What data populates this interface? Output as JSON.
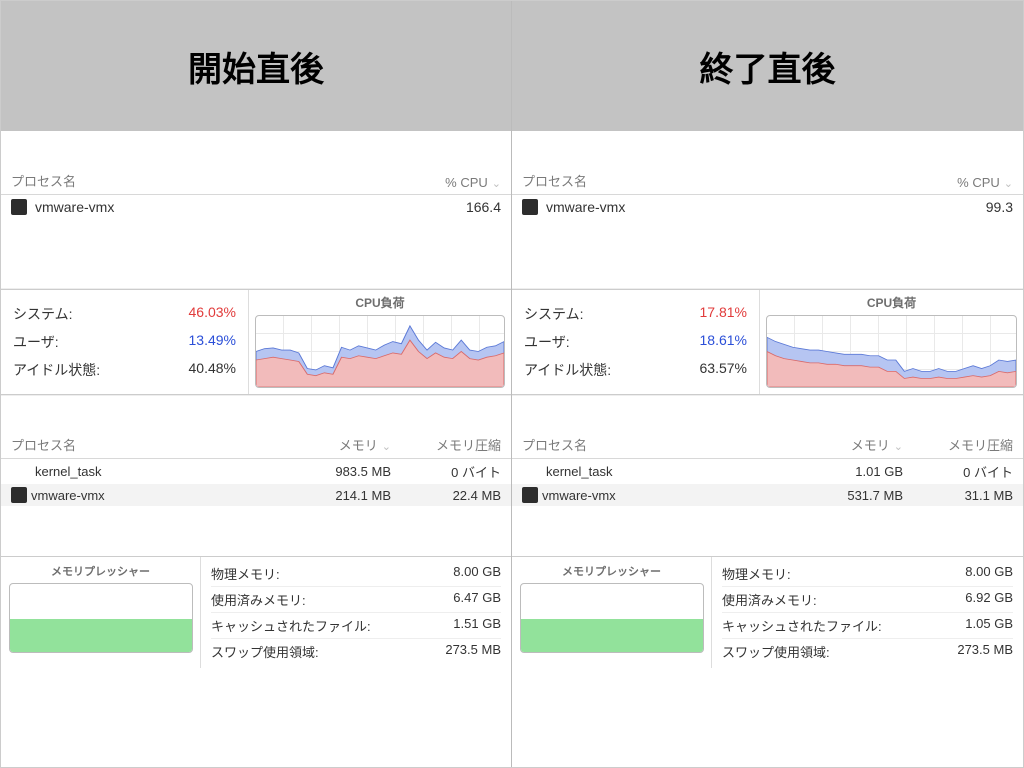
{
  "panes": [
    {
      "title": "開始直後",
      "cpu_proc": {
        "header_name": "プロセス名",
        "header_cpu": "% CPU",
        "rows": [
          {
            "name": "vmware-vmx",
            "cpu": "166.4",
            "has_icon": true
          }
        ]
      },
      "cpu_stats": {
        "system_label": "システム:",
        "system_val": "46.03%",
        "user_label": "ユーザ:",
        "user_val": "13.49%",
        "idle_label": "アイドル状態:",
        "idle_val": "40.48%",
        "chart_title": "CPU負荷"
      },
      "mem_proc": {
        "header_name": "プロセス名",
        "header_mem": "メモリ",
        "header_comp": "メモリ圧縮",
        "rows": [
          {
            "name": "kernel_task",
            "mem": "983.5 MB",
            "comp": "0 バイト",
            "has_icon": false
          },
          {
            "name": "vmware-vmx",
            "mem": "214.1 MB",
            "comp": "22.4 MB",
            "has_icon": true
          }
        ]
      },
      "mem_pressure": {
        "title": "メモリプレッシャー",
        "fill_pct": 48,
        "rows": [
          {
            "label": "物理メモリ:",
            "val": "8.00 GB"
          },
          {
            "label": "使用済みメモリ:",
            "val": "6.47 GB"
          },
          {
            "label": "キャッシュされたファイル:",
            "val": "1.51 GB"
          },
          {
            "label": "スワップ使用領域:",
            "val": "273.5 MB"
          }
        ]
      }
    },
    {
      "title": "終了直後",
      "cpu_proc": {
        "header_name": "プロセス名",
        "header_cpu": "% CPU",
        "rows": [
          {
            "name": "vmware-vmx",
            "cpu": "99.3",
            "has_icon": true
          }
        ]
      },
      "cpu_stats": {
        "system_label": "システム:",
        "system_val": "17.81%",
        "user_label": "ユーザ:",
        "user_val": "18.61%",
        "idle_label": "アイドル状態:",
        "idle_val": "63.57%",
        "chart_title": "CPU負荷"
      },
      "mem_proc": {
        "header_name": "プロセス名",
        "header_mem": "メモリ",
        "header_comp": "メモリ圧縮",
        "rows": [
          {
            "name": "kernel_task",
            "mem": "1.01 GB",
            "comp": "0 バイト",
            "has_icon": false
          },
          {
            "name": "vmware-vmx",
            "mem": "531.7 MB",
            "comp": "31.1 MB",
            "has_icon": true
          }
        ]
      },
      "mem_pressure": {
        "title": "メモリプレッシャー",
        "fill_pct": 48,
        "rows": [
          {
            "label": "物理メモリ:",
            "val": "8.00 GB"
          },
          {
            "label": "使用済みメモリ:",
            "val": "6.92 GB"
          },
          {
            "label": "キャッシュされたファイル:",
            "val": "1.05 GB"
          },
          {
            "label": "スワップ使用領域:",
            "val": "273.5 MB"
          }
        ]
      }
    }
  ],
  "chart_data": [
    {
      "type": "area",
      "title": "CPU負荷 (開始直後)",
      "x": [
        0,
        1,
        2,
        3,
        4,
        5,
        6,
        7,
        8,
        9,
        10,
        11,
        12,
        13,
        14,
        15,
        16,
        17,
        18,
        19,
        20,
        21,
        22,
        23,
        24,
        25,
        26,
        27,
        28,
        29
      ],
      "series": [
        {
          "name": "システム",
          "color": "#e98989",
          "values": [
            38,
            40,
            42,
            40,
            38,
            36,
            18,
            16,
            20,
            18,
            42,
            40,
            44,
            42,
            40,
            44,
            48,
            46,
            66,
            50,
            40,
            48,
            42,
            40,
            50,
            40,
            38,
            42,
            44,
            48
          ]
        },
        {
          "name": "ユーザ",
          "color": "#8aa3f0",
          "values": [
            12,
            14,
            13,
            12,
            14,
            12,
            8,
            8,
            10,
            9,
            14,
            12,
            14,
            13,
            12,
            15,
            16,
            15,
            20,
            16,
            12,
            15,
            13,
            12,
            16,
            12,
            12,
            14,
            14,
            16
          ]
        }
      ],
      "ylim": [
        0,
        100
      ]
    },
    {
      "type": "area",
      "title": "CPU負荷 (終了直後)",
      "x": [
        0,
        1,
        2,
        3,
        4,
        5,
        6,
        7,
        8,
        9,
        10,
        11,
        12,
        13,
        14,
        15,
        16,
        17,
        18,
        19,
        20,
        21,
        22,
        23,
        24,
        25,
        26,
        27,
        28,
        29
      ],
      "series": [
        {
          "name": "システム",
          "color": "#e98989",
          "values": [
            50,
            44,
            40,
            38,
            36,
            34,
            34,
            32,
            32,
            30,
            30,
            30,
            28,
            28,
            22,
            22,
            12,
            14,
            12,
            12,
            14,
            12,
            12,
            14,
            16,
            14,
            16,
            22,
            20,
            22
          ]
        },
        {
          "name": "ユーザ",
          "color": "#8aa3f0",
          "values": [
            20,
            20,
            20,
            18,
            18,
            18,
            18,
            18,
            16,
            16,
            16,
            16,
            16,
            16,
            16,
            16,
            10,
            12,
            10,
            10,
            12,
            10,
            10,
            12,
            14,
            12,
            14,
            16,
            16,
            16
          ]
        }
      ],
      "ylim": [
        0,
        100
      ]
    }
  ]
}
